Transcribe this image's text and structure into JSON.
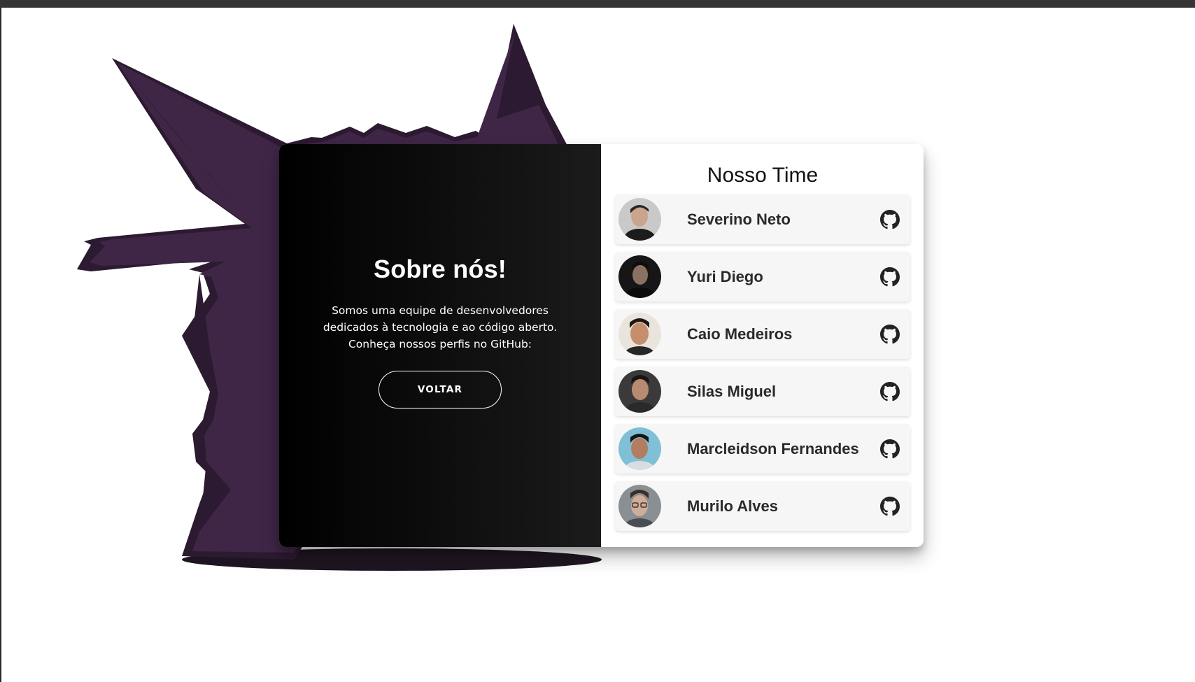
{
  "about": {
    "title": "Sobre nós!",
    "text": "Somos uma equipe de desenvolvedores dedicados à tecnologia e ao código aberto. Conheça nossos perfis no GitHub:",
    "back_label": "VOLTAR"
  },
  "team": {
    "title": "Nosso Time",
    "members": [
      {
        "name": "Severino Neto",
        "icon": "github-icon"
      },
      {
        "name": "Yuri Diego",
        "icon": "github-icon"
      },
      {
        "name": "Caio Medeiros",
        "icon": "github-icon"
      },
      {
        "name": "Silas Miguel",
        "icon": "github-icon"
      },
      {
        "name": "Marcleidson Fernandes",
        "icon": "github-icon"
      },
      {
        "name": "Murilo Alves",
        "icon": "github-icon"
      }
    ]
  },
  "colors": {
    "monster": "#3f2647",
    "monster_shadow": "#2c1a31",
    "panel_dark": "#000000",
    "panel_light": "#ffffff",
    "member_bg": "#f6f6f6"
  }
}
